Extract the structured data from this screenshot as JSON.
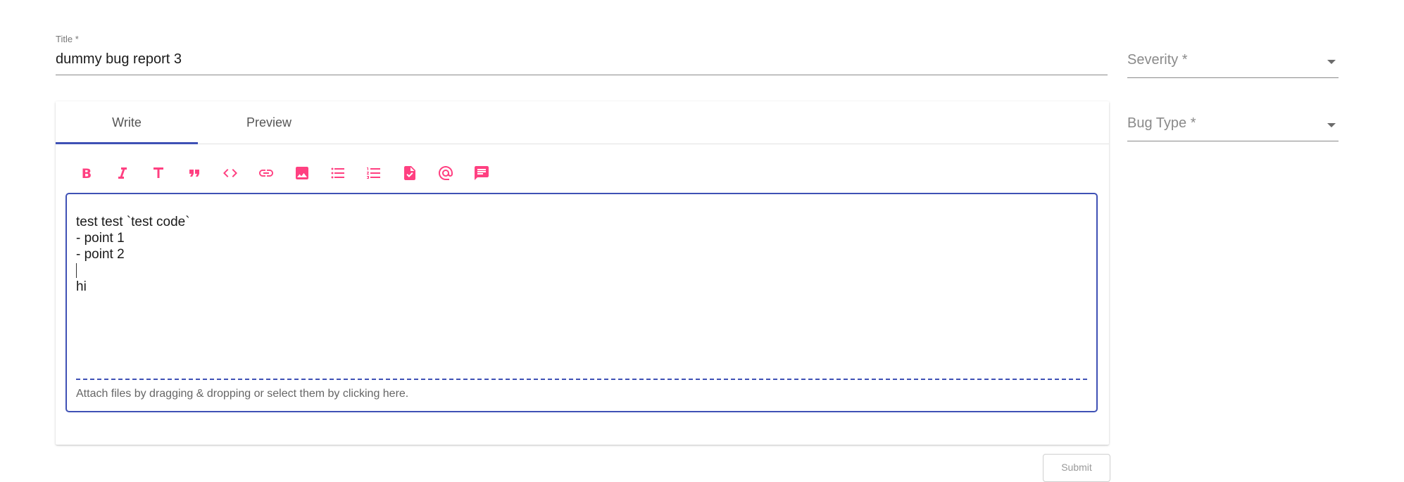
{
  "title_field": {
    "label": "Title *",
    "value": "dummy bug report 3"
  },
  "severity_select": {
    "label": "Severity *"
  },
  "bug_type_select": {
    "label": "Bug Type *"
  },
  "tabs": [
    {
      "label": "Write",
      "active": true
    },
    {
      "label": "Preview",
      "active": false
    }
  ],
  "toolbar": {
    "icon_color": "#ff4081",
    "buttons": [
      {
        "name": "bold-icon"
      },
      {
        "name": "italic-icon"
      },
      {
        "name": "heading-icon"
      },
      {
        "name": "quote-icon"
      },
      {
        "name": "code-icon"
      },
      {
        "name": "link-icon"
      },
      {
        "name": "image-icon"
      },
      {
        "name": "bulleted-list-icon"
      },
      {
        "name": "numbered-list-icon"
      },
      {
        "name": "task-list-icon"
      },
      {
        "name": "mention-icon"
      },
      {
        "name": "saved-replies-icon"
      }
    ]
  },
  "editor": {
    "lines": [
      "test test `test code`",
      "- point 1",
      "- point 2",
      "",
      "hi"
    ],
    "attach_text": "Attach files by dragging & dropping or select them by clicking here."
  },
  "submit": {
    "label": "Submit"
  },
  "colors": {
    "accent": "#3f51b5",
    "icon": "#ff4081"
  }
}
